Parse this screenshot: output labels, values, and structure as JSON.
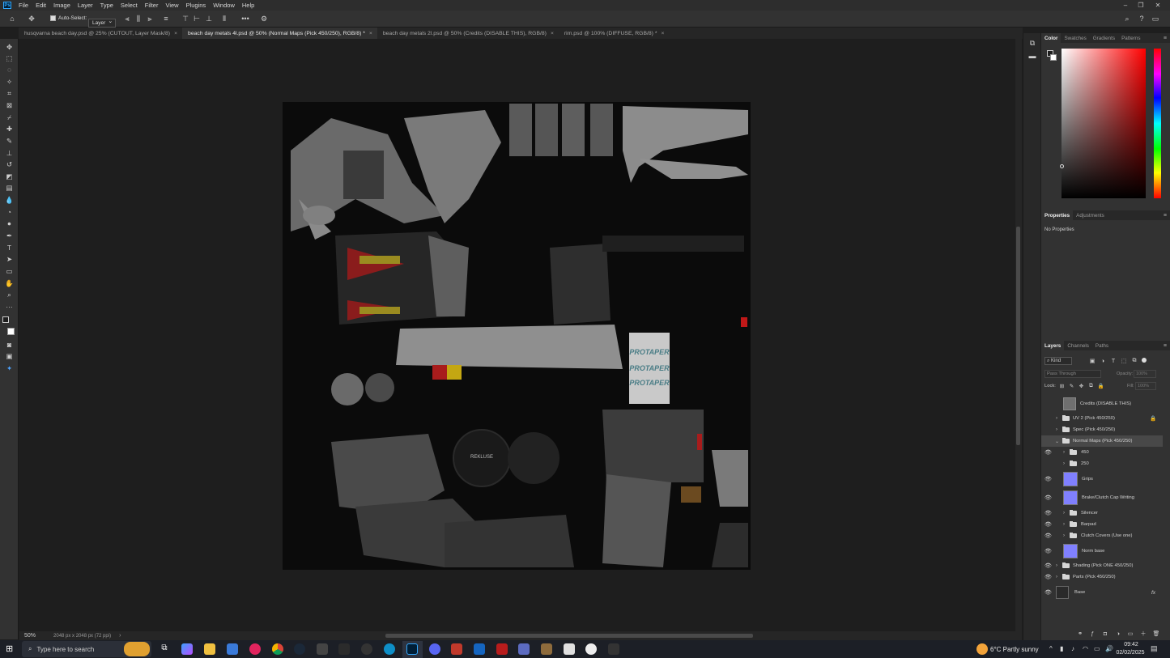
{
  "menubar": {
    "app_logo": "Ps",
    "items": [
      "File",
      "Edit",
      "Image",
      "Layer",
      "Type",
      "Select",
      "Filter",
      "View",
      "Plugins",
      "Window",
      "Help"
    ],
    "window_controls": [
      "minimize-icon",
      "restore-icon",
      "close-icon"
    ]
  },
  "options": {
    "auto_select_label": "Auto-Select:",
    "auto_select_value": "Layer",
    "more_label": "•••"
  },
  "tabs": [
    {
      "label": "husqvarna beach day.psd @ 25% (CUTOUT, Layer Mask/8)",
      "active": false
    },
    {
      "label": "beach day metals 4l.psd @ 50% (Normal Maps (Pick 450/250), RGB/8) *",
      "active": true
    },
    {
      "label": "beach day metals 2l.psd @ 50% (Credits (DISABLE THIS), RGB/8)",
      "active": false
    },
    {
      "label": "rim.psd @ 100% (DIFFUSE, RGB/8) *",
      "active": false
    }
  ],
  "status": {
    "zoom": "50%",
    "doc_info": "2048 px x 2048 px (72 ppi)"
  },
  "canvas_labels": {
    "protaper_1": "PROTAPER",
    "protaper_2": "PROTAPER",
    "protaper_3": "PROTAPER",
    "rekluse": "REKLUSE"
  },
  "color_panel": {
    "tabs": [
      "Color",
      "Swatches",
      "Gradients",
      "Patterns"
    ],
    "active_tab": "Color",
    "hue_color": "#ff0000"
  },
  "properties_panel": {
    "tabs": [
      "Properties",
      "Adjustments"
    ],
    "empty_text": "No Properties"
  },
  "layers_panel": {
    "tabs": [
      "Layers",
      "Channels",
      "Paths"
    ],
    "filter_kind": "Kind",
    "blend_mode": "Pass Through",
    "opacity_label": "Opacity:",
    "opacity_value": "100%",
    "lock_label": "Lock:",
    "fill_label": "Fill:",
    "fill_value": "100%",
    "layers": [
      {
        "name": "Credits (DISABLE THIS)",
        "type": "image",
        "visible": false,
        "indent": 0
      },
      {
        "name": "UV 2 (Pick 450/250)",
        "type": "folder",
        "visible": false,
        "indent": 0,
        "locked": true
      },
      {
        "name": "Spec (Pick 450/250)",
        "type": "folder",
        "visible": false,
        "indent": 0
      },
      {
        "name": "Normal Maps (Pick 450/250)",
        "type": "folder-open",
        "visible": false,
        "indent": 0,
        "selected": true
      },
      {
        "name": "450",
        "type": "folder",
        "visible": true,
        "indent": 1
      },
      {
        "name": "250",
        "type": "folder",
        "visible": false,
        "indent": 1
      },
      {
        "name": "Grips",
        "type": "normal",
        "visible": true,
        "indent": 1
      },
      {
        "name": "Brake/Clutch Cap Writing",
        "type": "normal",
        "visible": true,
        "indent": 1
      },
      {
        "name": "Silencer",
        "type": "folder",
        "visible": true,
        "indent": 1
      },
      {
        "name": "Barpad",
        "type": "folder",
        "visible": true,
        "indent": 1
      },
      {
        "name": "Clutch Covers (Use one)",
        "type": "folder",
        "visible": true,
        "indent": 1
      },
      {
        "name": "Norm base",
        "type": "normal",
        "visible": true,
        "indent": 1
      },
      {
        "name": "Shading (Pick ONE 450/250)",
        "type": "folder",
        "visible": true,
        "indent": 0
      },
      {
        "name": "Parts (Pick 450/250)",
        "type": "folder",
        "visible": true,
        "indent": 0
      },
      {
        "name": "Base",
        "type": "image",
        "visible": true,
        "indent": 0,
        "fx": true
      }
    ],
    "fx_label": "fx"
  },
  "taskbar": {
    "search_placeholder": "Type here to search",
    "weather": "6°C  Partly sunny",
    "time": "09:42",
    "date": "02/02/2025"
  }
}
